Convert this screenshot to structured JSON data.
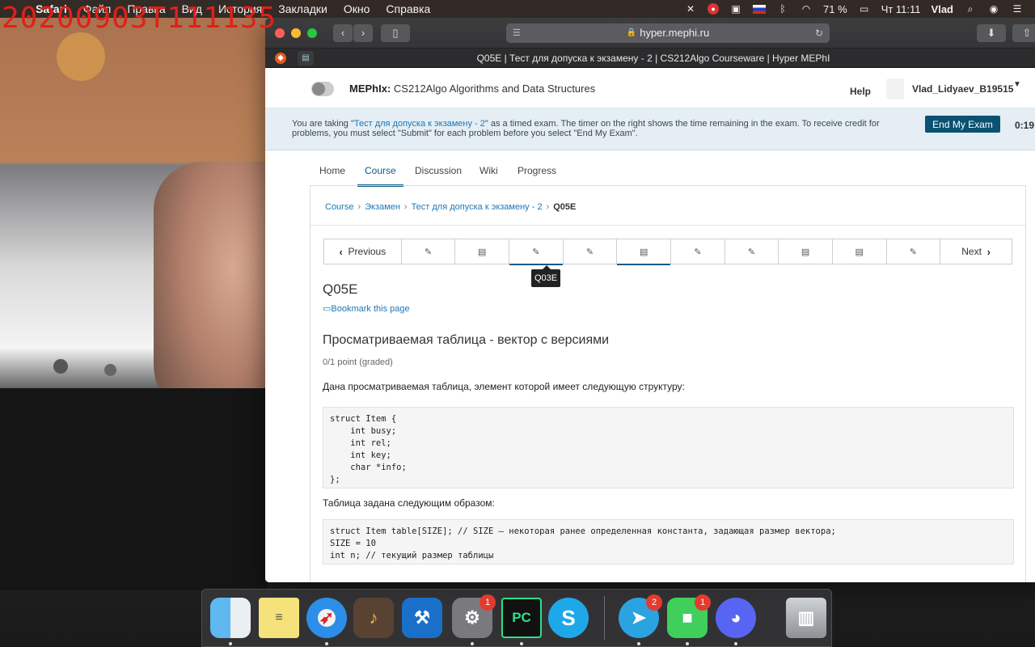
{
  "overlay_timestamp": "20200903T111135",
  "menubar": {
    "apple_icon": "apple-icon",
    "items": [
      "Safari",
      "Файл",
      "Правка",
      "Вид",
      "История",
      "Закладки",
      "Окно",
      "Справка"
    ],
    "battery": "71 %",
    "clock": "Чт 11:11",
    "user": "Vlad"
  },
  "browser": {
    "url": "hyper.mephi.ru",
    "tab_title": "Q05E | Тест для допуска к экзамену - 2 | CS212Algo Courseware | Hyper MEPhI"
  },
  "site": {
    "org": "MEPhIx:",
    "course": "CS212Algo Algorithms and Data Structures",
    "help": "Help",
    "username": "Vlad_Lidyaev_B19515"
  },
  "exam": {
    "text_before": "You are taking \"",
    "exam_link": "Тест для допуска к экзамену - 2",
    "text_after": "\" as a timed exam. The timer on the right shows the time remaining in the exam. To receive credit for problems, you must select \"Submit\" for each problem before you select \"End My Exam\".",
    "end_button": "End My Exam",
    "timer": "0:19:"
  },
  "course_nav": [
    "Home",
    "Course",
    "Discussion",
    "Wiki",
    "Progress"
  ],
  "breadcrumb": {
    "items": [
      "Course",
      "Экзамен",
      "Тест для допуска к экзамену - 2"
    ],
    "current": "Q05E"
  },
  "sequence": {
    "prev": "Previous",
    "next": "Next",
    "tooltip": "Q03E"
  },
  "unit": {
    "title": "Q05E",
    "bookmark": "Bookmark this page",
    "problem_title": "Просматриваемая таблица - вектор с версиями",
    "points": "0/1 point (graded)",
    "para1": "Дана просматриваемая таблица, элемент которой имеет следующую структуру:",
    "code1": "struct Item {\n    int busy;\n    int rel;\n    int key;\n    char *info;\n};",
    "para2": "Таблица задана следующим образом:",
    "code2": "struct Item table[SIZE]; // SIZE – некоторая ранее определенная константа, задающая размер вектора;\nSIZE = 10\nint n; // текущий размер таблицы"
  },
  "dock": {
    "telegram_badge": "2",
    "facetime_badge": "1",
    "sysprefs_badge": "1"
  }
}
